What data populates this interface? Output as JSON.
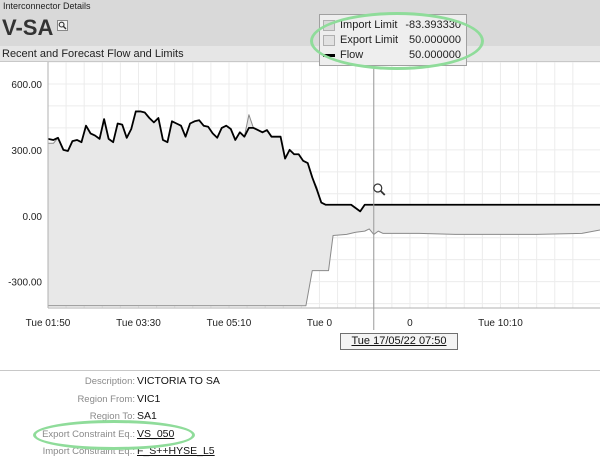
{
  "window_title": "Interconnector Details",
  "header": {
    "title": "V-SA",
    "zoom_icon": "magnifier-icon"
  },
  "chart_panel_title": "Recent and Forecast Flow and Limits",
  "legend": {
    "items": [
      {
        "name": "Import Limit",
        "value": "-83.393330",
        "swatch": "#d9d9d9"
      },
      {
        "name": "Export Limit",
        "value": "50.000000",
        "swatch": "#e2e2e2"
      },
      {
        "name": "Flow",
        "value": "50.000000",
        "swatch": "#000000"
      }
    ]
  },
  "tooltip": {
    "text": "Tue 17/05/22 07:50"
  },
  "chart_data": {
    "type": "line",
    "ylim": [
      -420,
      700
    ],
    "y_ticks": [
      -300,
      0,
      300,
      600
    ],
    "y_tick_labels": [
      "-300.00",
      "0.00",
      "300.00",
      "600.00"
    ],
    "x_tick_labels": [
      "Tue 01:50",
      "Tue 03:30",
      "Tue 05:10",
      "Tue 0",
      "0",
      "Tue 10:10"
    ],
    "x_tick_minutes": [
      110,
      210,
      310,
      410,
      510,
      610
    ],
    "xlim": [
      110,
      720
    ],
    "cursor_minute": 470,
    "grid": true,
    "series": [
      {
        "name": "Flow",
        "color": "#000000",
        "points": [
          [
            110,
            350
          ],
          [
            116,
            345
          ],
          [
            121,
            355
          ],
          [
            127,
            300
          ],
          [
            132,
            295
          ],
          [
            137,
            340
          ],
          [
            142,
            345
          ],
          [
            147,
            335
          ],
          [
            152,
            410
          ],
          [
            157,
            375
          ],
          [
            162,
            365
          ],
          [
            167,
            350
          ],
          [
            172,
            440
          ],
          [
            177,
            350
          ],
          [
            182,
            335
          ],
          [
            187,
            420
          ],
          [
            192,
            415
          ],
          [
            197,
            355
          ],
          [
            202,
            395
          ],
          [
            207,
            475
          ],
          [
            212,
            475
          ],
          [
            217,
            470
          ],
          [
            222,
            445
          ],
          [
            227,
            425
          ],
          [
            232,
            445
          ],
          [
            237,
            345
          ],
          [
            242,
            335
          ],
          [
            247,
            430
          ],
          [
            252,
            420
          ],
          [
            257,
            410
          ],
          [
            262,
            360
          ],
          [
            267,
            420
          ],
          [
            272,
            430
          ],
          [
            277,
            435
          ],
          [
            282,
            410
          ],
          [
            287,
            405
          ],
          [
            292,
            375
          ],
          [
            297,
            355
          ],
          [
            302,
            400
          ],
          [
            307,
            410
          ],
          [
            312,
            395
          ],
          [
            317,
            345
          ],
          [
            322,
            380
          ],
          [
            327,
            360
          ],
          [
            332,
            400
          ],
          [
            337,
            400
          ],
          [
            342,
            390
          ],
          [
            347,
            380
          ],
          [
            352,
            390
          ],
          [
            357,
            360
          ],
          [
            362,
            360
          ],
          [
            367,
            360
          ],
          [
            372,
            260
          ],
          [
            377,
            300
          ],
          [
            382,
            280
          ],
          [
            387,
            280
          ],
          [
            392,
            250
          ],
          [
            397,
            240
          ],
          [
            402,
            175
          ],
          [
            407,
            120
          ],
          [
            412,
            60
          ],
          [
            417,
            50
          ],
          [
            430,
            50
          ],
          [
            445,
            50
          ],
          [
            455,
            20
          ],
          [
            460,
            50
          ],
          [
            470,
            50
          ],
          [
            500,
            50
          ],
          [
            560,
            50
          ],
          [
            620,
            50
          ],
          [
            700,
            50
          ],
          [
            720,
            50
          ]
        ]
      },
      {
        "name": "Export Limit",
        "color": "#8a8a8a",
        "points": [
          [
            110,
            330
          ],
          [
            116,
            330
          ],
          [
            121,
            355
          ],
          [
            127,
            300
          ],
          [
            132,
            295
          ],
          [
            137,
            340
          ],
          [
            142,
            345
          ],
          [
            147,
            335
          ],
          [
            152,
            410
          ],
          [
            157,
            375
          ],
          [
            162,
            365
          ],
          [
            167,
            350
          ],
          [
            172,
            440
          ],
          [
            177,
            350
          ],
          [
            182,
            335
          ],
          [
            187,
            420
          ],
          [
            192,
            415
          ],
          [
            197,
            355
          ],
          [
            202,
            395
          ],
          [
            207,
            475
          ],
          [
            212,
            475
          ],
          [
            217,
            470
          ],
          [
            222,
            445
          ],
          [
            227,
            425
          ],
          [
            232,
            445
          ],
          [
            237,
            345
          ],
          [
            242,
            335
          ],
          [
            247,
            430
          ],
          [
            252,
            420
          ],
          [
            257,
            410
          ],
          [
            262,
            360
          ],
          [
            267,
            420
          ],
          [
            272,
            430
          ],
          [
            277,
            435
          ],
          [
            282,
            410
          ],
          [
            287,
            405
          ],
          [
            292,
            375
          ],
          [
            297,
            355
          ],
          [
            302,
            400
          ],
          [
            307,
            410
          ],
          [
            312,
            395
          ],
          [
            317,
            345
          ],
          [
            322,
            380
          ],
          [
            327,
            360
          ],
          [
            332,
            460
          ],
          [
            337,
            400
          ],
          [
            342,
            390
          ],
          [
            347,
            380
          ],
          [
            352,
            390
          ],
          [
            357,
            360
          ],
          [
            362,
            360
          ],
          [
            367,
            360
          ],
          [
            372,
            260
          ],
          [
            377,
            300
          ],
          [
            382,
            280
          ],
          [
            387,
            280
          ],
          [
            392,
            250
          ],
          [
            397,
            240
          ],
          [
            402,
            175
          ],
          [
            407,
            130
          ],
          [
            412,
            60
          ],
          [
            417,
            50
          ],
          [
            430,
            50
          ],
          [
            445,
            50
          ],
          [
            455,
            20
          ],
          [
            460,
            50
          ],
          [
            470,
            50
          ],
          [
            500,
            50
          ],
          [
            560,
            50
          ],
          [
            620,
            50
          ],
          [
            700,
            50
          ],
          [
            720,
            50
          ]
        ]
      },
      {
        "name": "Import Limit",
        "color": "#8a8a8a",
        "points": [
          [
            110,
            -410
          ],
          [
            200,
            -410
          ],
          [
            300,
            -410
          ],
          [
            395,
            -410
          ],
          [
            402,
            -250
          ],
          [
            420,
            -250
          ],
          [
            425,
            -90
          ],
          [
            440,
            -85
          ],
          [
            450,
            -75
          ],
          [
            460,
            -70
          ],
          [
            465,
            -60
          ],
          [
            470,
            -85
          ],
          [
            475,
            -70
          ],
          [
            480,
            -80
          ],
          [
            490,
            -80
          ],
          [
            520,
            -80
          ],
          [
            560,
            -85
          ],
          [
            600,
            -85
          ],
          [
            650,
            -85
          ],
          [
            700,
            -80
          ],
          [
            720,
            -65
          ]
        ]
      }
    ]
  },
  "details": [
    {
      "label": "Description:",
      "value": "VICTORIA TO SA",
      "link": false
    },
    {
      "label": "Region From:",
      "value": "VIC1",
      "link": false
    },
    {
      "label": "Region To:",
      "value": "SA1",
      "link": false
    },
    {
      "label": "Export Constraint Eq.:",
      "value": "VS_050",
      "link": true
    },
    {
      "label": "Import Constraint Eq.:",
      "value": "F_S++HYSE_L5",
      "link": true
    }
  ],
  "annotation_color": "#8fdc9a"
}
